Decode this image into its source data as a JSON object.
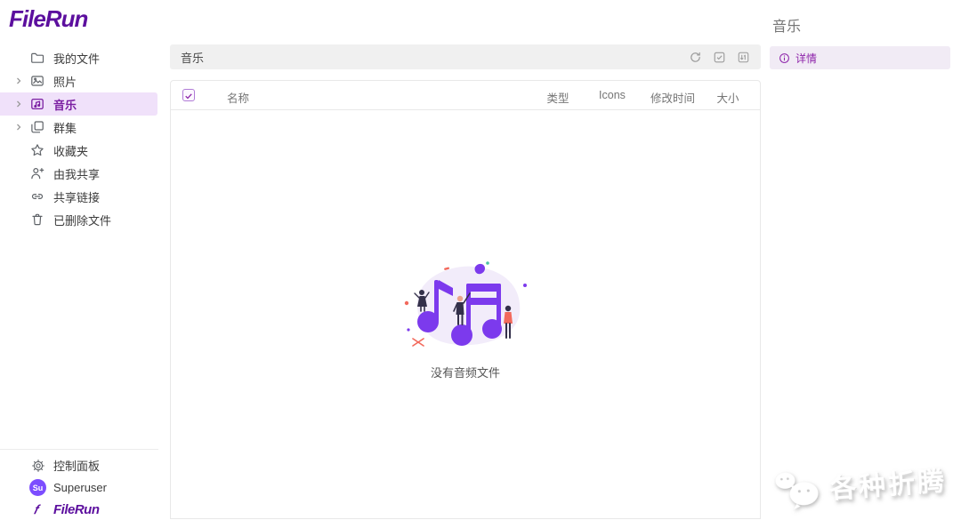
{
  "brand": {
    "logo_text": "FileRun",
    "accent_color": "#5c0f9e"
  },
  "sidebar": {
    "items": [
      {
        "label": "我的文件",
        "icon": "folder-icon",
        "expandable": false,
        "selected": false
      },
      {
        "label": "照片",
        "icon": "photos-icon",
        "expandable": true,
        "selected": false
      },
      {
        "label": "音乐",
        "icon": "music-folder-icon",
        "expandable": true,
        "selected": true
      },
      {
        "label": "群集",
        "icon": "collections-icon",
        "expandable": true,
        "selected": false
      },
      {
        "label": "收藏夹",
        "icon": "star-icon",
        "expandable": false,
        "selected": false
      },
      {
        "label": "由我共享",
        "icon": "share-user-icon",
        "expandable": false,
        "selected": false
      },
      {
        "label": "共享链接",
        "icon": "link-icon",
        "expandable": false,
        "selected": false
      },
      {
        "label": "已删除文件",
        "icon": "trash-icon",
        "expandable": false,
        "selected": false
      }
    ],
    "footer": {
      "control_panel_label": "控制面板",
      "user_name": "Superuser",
      "user_avatar_initials": "Su",
      "footer_logo_text": "FileRun"
    },
    "selected_bg": "#f0e1fa"
  },
  "toolbar": {
    "breadcrumb": "音乐",
    "icons": [
      "refresh-icon",
      "select-mode-icon",
      "sort-icon"
    ],
    "bg": "#f0f0f0"
  },
  "table": {
    "headers": {
      "name": "名称",
      "type": "类型",
      "icons": "Icons",
      "modified": "修改时间",
      "size": "大小"
    },
    "rows": []
  },
  "empty_state": {
    "message": "没有音频文件",
    "illustration": "music-notes-illustration",
    "illustration_color": "#7c3aed"
  },
  "details_panel": {
    "title": "音乐",
    "tab_label": "详情",
    "tab_bg": "#f1ebf5"
  },
  "watermark": {
    "text": "各种折腾",
    "icon": "wechat-bubbles-icon"
  }
}
